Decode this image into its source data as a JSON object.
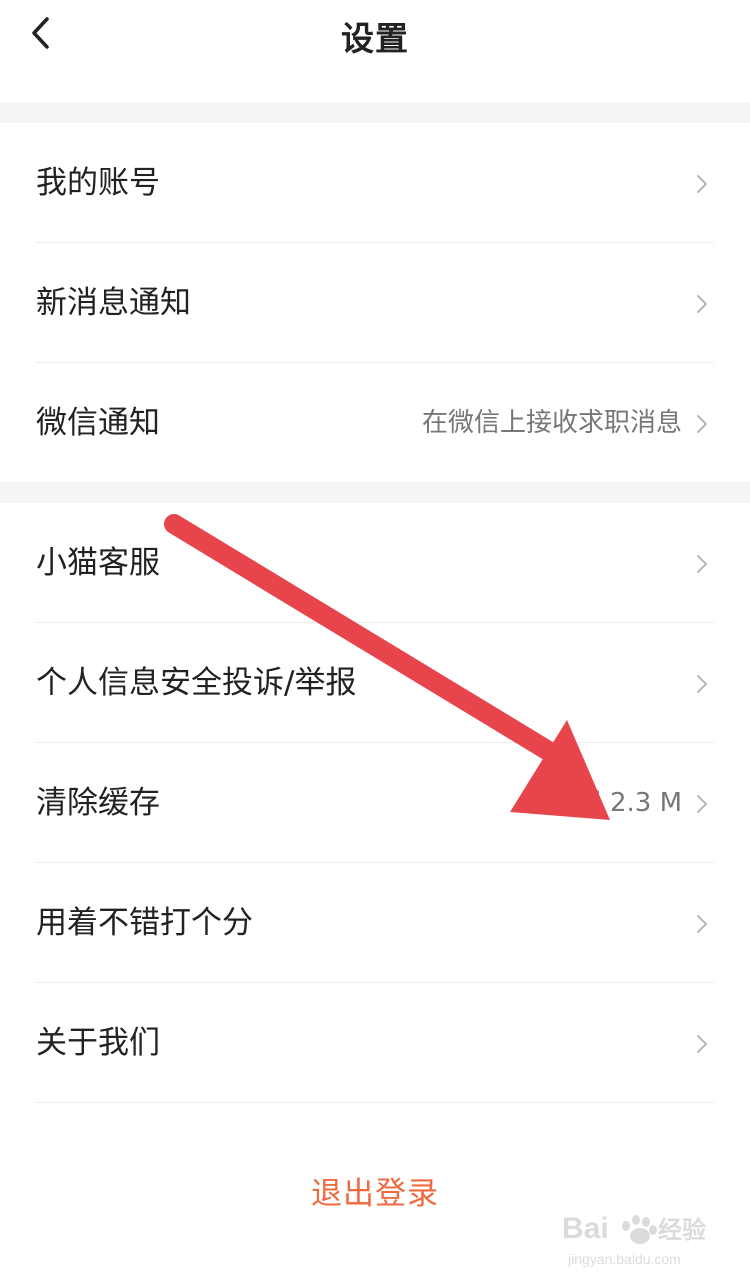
{
  "nav": {
    "title": "设置",
    "back_icon": "chevron-left-icon"
  },
  "group1": [
    {
      "label": "我的账号",
      "value": ""
    },
    {
      "label": "新消息通知",
      "value": ""
    },
    {
      "label": "微信通知",
      "value": "在微信上接收求职消息"
    }
  ],
  "group2": [
    {
      "label": "小猫客服",
      "value": ""
    },
    {
      "label": "个人信息安全投诉/举报",
      "value": ""
    },
    {
      "label": "清除缓存",
      "value": "已使用 2.3 M"
    },
    {
      "label": "用着不错打个分",
      "value": ""
    },
    {
      "label": "关于我们",
      "value": ""
    }
  ],
  "logout_label": "退出登录",
  "annotation": {
    "type": "red-arrow",
    "color": "#e8444c"
  },
  "watermark": {
    "brand": "Baidu经验",
    "url": "jingyan.baidu.com"
  },
  "colors": {
    "accent": "#f06a3f",
    "divider": "#ececec",
    "section_gap": "#f5f5f5"
  }
}
